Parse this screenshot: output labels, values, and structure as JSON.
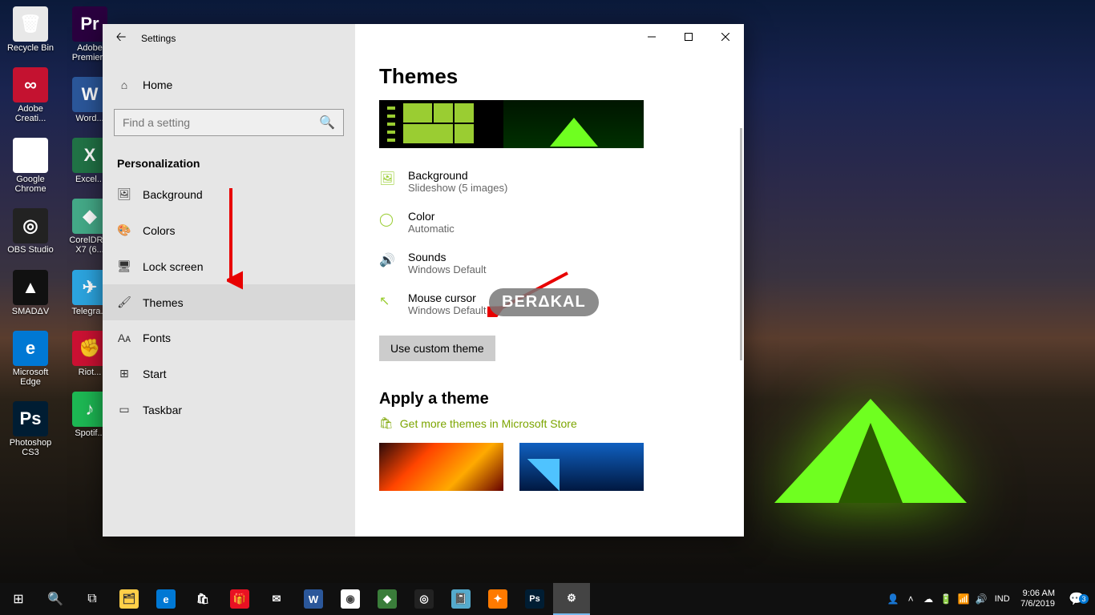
{
  "desktop": {
    "col1": [
      {
        "label": "Recycle Bin",
        "bg": "#e8e8e8",
        "glyph": "🗑"
      },
      {
        "label": "Adobe Creati...",
        "bg": "#c41230",
        "glyph": "∞"
      },
      {
        "label": "Google Chrome",
        "bg": "#fff",
        "glyph": "◉"
      },
      {
        "label": "OBS Studio",
        "bg": "#222",
        "glyph": "◎"
      },
      {
        "label": "SMADΔV",
        "bg": "#111",
        "glyph": "▲"
      },
      {
        "label": "Microsoft Edge",
        "bg": "#0078d4",
        "glyph": "e"
      },
      {
        "label": "Photoshop CS3",
        "bg": "#001d33",
        "glyph": "Ps"
      }
    ],
    "col2": [
      {
        "label": "Adobe Premiere",
        "bg": "#2a003f",
        "glyph": "Pr"
      },
      {
        "label": "Word...",
        "bg": "#2b579a",
        "glyph": "W"
      },
      {
        "label": "Excel...",
        "bg": "#217346",
        "glyph": "X"
      },
      {
        "label": "CorelDR... X7 (6...",
        "bg": "#4a8",
        "glyph": "◆"
      },
      {
        "label": "Telegra...",
        "bg": "#2ca5e0",
        "glyph": "✈"
      },
      {
        "label": "Riot...",
        "bg": "#c13",
        "glyph": "✊"
      },
      {
        "label": "Spotif...",
        "bg": "#1db954",
        "glyph": "♪"
      }
    ]
  },
  "settings": {
    "title": "Settings",
    "home": "Home",
    "search_placeholder": "Find a setting",
    "section": "Personalization",
    "nav": [
      {
        "icon": "🖼",
        "label": "Background"
      },
      {
        "icon": "🎨",
        "label": "Colors"
      },
      {
        "icon": "🖥",
        "label": "Lock screen"
      },
      {
        "icon": "🖌",
        "label": "Themes"
      },
      {
        "icon": "Aᴀ",
        "label": "Fonts"
      },
      {
        "icon": "⊞",
        "label": "Start"
      },
      {
        "icon": "▭",
        "label": "Taskbar"
      }
    ],
    "page_title": "Themes",
    "rows": [
      {
        "title": "Background",
        "sub": "Slideshow (5 images)"
      },
      {
        "title": "Color",
        "sub": "Automatic"
      },
      {
        "title": "Sounds",
        "sub": "Windows Default"
      },
      {
        "title": "Mouse cursor",
        "sub": "Windows Default"
      }
    ],
    "custom_button": "Use custom theme",
    "apply_header": "Apply a theme",
    "store_link": "Get more themes in Microsoft Store"
  },
  "watermark": "BERΔKAL",
  "taskbar": {
    "lang": "IND",
    "time": "9:06 AM",
    "date": "7/6/2019",
    "notif_count": "3"
  }
}
